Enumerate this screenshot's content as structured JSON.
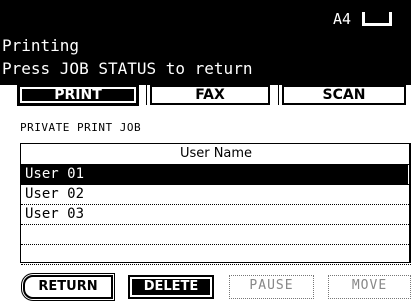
{
  "header": {
    "paper_size": "A4",
    "paper_icon": "paper-orientation-icon",
    "status_line1": "Printing",
    "status_line2": "Press JOB STATUS to return"
  },
  "tabs": [
    {
      "label": "PRINT",
      "active": true
    },
    {
      "label": "FAX",
      "active": false
    },
    {
      "label": "SCAN",
      "active": false
    }
  ],
  "section": {
    "title": "PRIVATE PRINT JOB"
  },
  "table": {
    "header": "User Name",
    "rows": [
      "User 01",
      "User 02",
      "User 03",
      "",
      ""
    ],
    "selected_index": 0
  },
  "buttons": {
    "return_label": "RETURN",
    "delete_label": "DELETE",
    "pause_label": "PAUSE",
    "move_label": "MOVE"
  },
  "colors": {
    "foreground": "#000000",
    "background": "#ffffff",
    "disabled": "#888888"
  }
}
